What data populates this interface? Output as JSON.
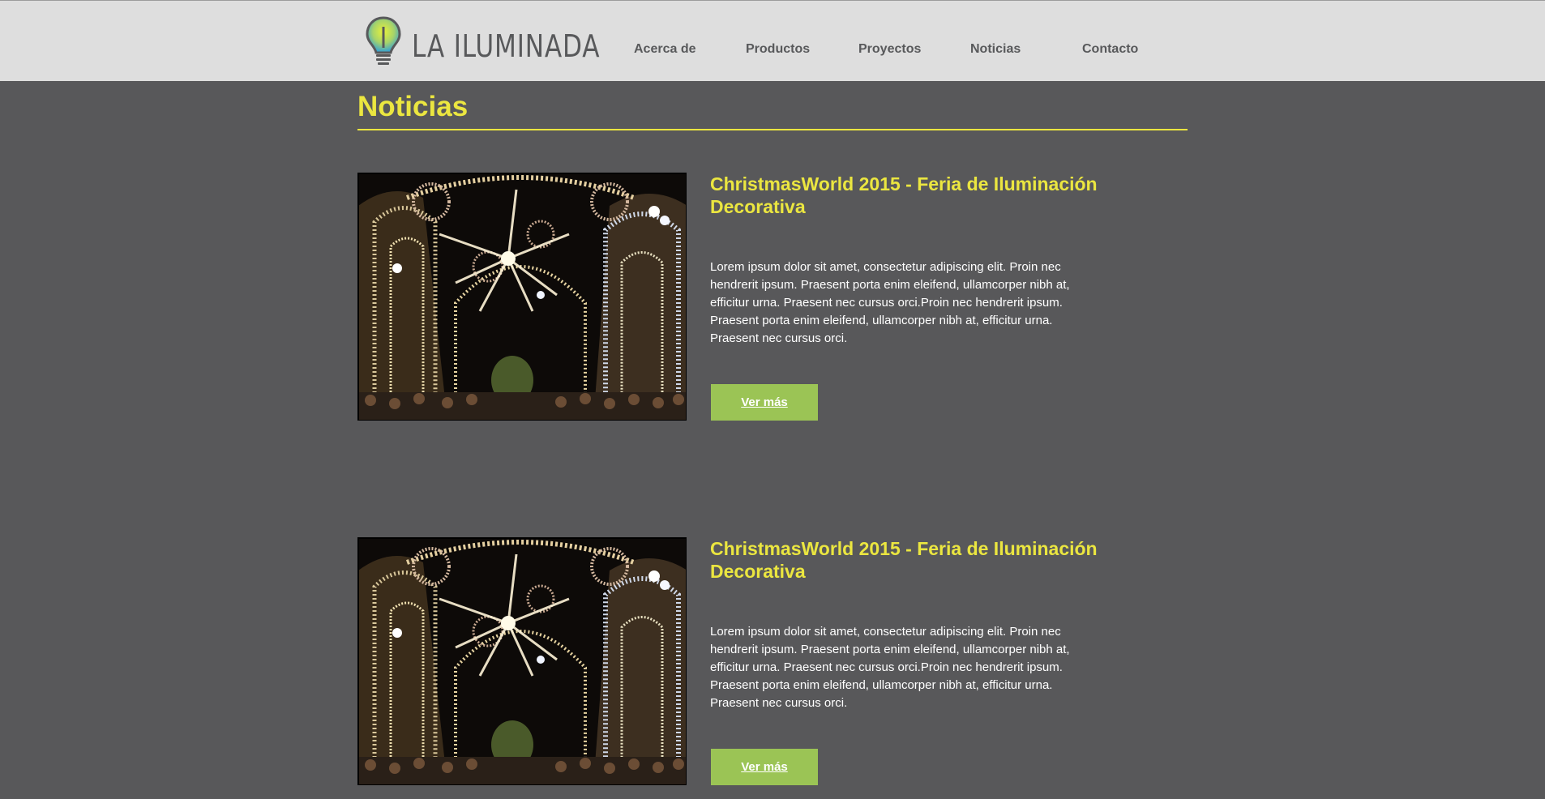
{
  "header": {
    "logo_text": "LA ILUMINADA",
    "logo_icon": "lightbulb-icon",
    "nav": [
      {
        "label": "Acerca de"
      },
      {
        "label": "Productos"
      },
      {
        "label": "Proyectos"
      },
      {
        "label": "Noticias"
      },
      {
        "label": "Contacto"
      }
    ]
  },
  "main": {
    "title": "Noticias",
    "news": [
      {
        "title": "ChristmasWorld 2015 - Feria de Iluminación Decorativa",
        "body": "Lorem ipsum dolor sit amet, consectetur adipiscing elit. Proin nec hendrerit ipsum. Praesent porta enim eleifend, ullamcorper nibh at, efficitur urna. Praesent nec cursus orci.Proin nec hendrerit ipsum. Praesent porta enim eleifend, ullamcorper nibh at, efficitur urna. Praesent nec cursus orci.",
        "button": "Ver más"
      },
      {
        "title": "ChristmasWorld 2015 - Feria de Iluminación Decorativa",
        "body": "Lorem ipsum dolor sit amet, consectetur adipiscing elit. Proin nec hendrerit ipsum. Praesent porta enim eleifend, ullamcorper nibh at, efficitur urna. Praesent nec cursus orci.Proin nec hendrerit ipsum. Praesent porta enim eleifend, ullamcorper nibh at, efficitur urna. Praesent nec cursus orci.",
        "button": "Ver más"
      }
    ]
  },
  "colors": {
    "background": "#58585a",
    "header": "#dedede",
    "accent_yellow": "#ebe640",
    "button_green": "#9bc455",
    "nav_text": "#58595b"
  }
}
